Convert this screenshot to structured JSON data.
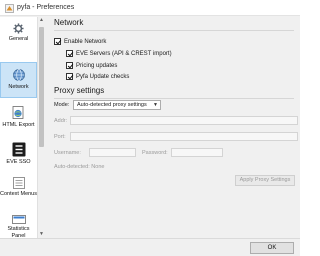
{
  "window": {
    "title": "pyfa - Preferences"
  },
  "sidebar": {
    "items": [
      {
        "label": "General",
        "icon": "gear-icon",
        "selected": false
      },
      {
        "label": "Network",
        "icon": "network-icon",
        "selected": true
      },
      {
        "label": "HTML Export",
        "icon": "html-export-icon",
        "selected": false
      },
      {
        "label": "EVE SSO",
        "icon": "eve-sso-icon",
        "selected": false
      },
      {
        "label": "Context Menus",
        "icon": "context-menus-icon",
        "selected": false
      },
      {
        "label": "Statistics Panel",
        "icon": "statistics-panel-icon",
        "selected": false
      }
    ]
  },
  "network": {
    "title": "Network",
    "enable_network": {
      "label": "Enable Network",
      "checked": true
    },
    "options": [
      {
        "label": "EVE Servers (API & CREST import)",
        "checked": true
      },
      {
        "label": "Pricing updates",
        "checked": true
      },
      {
        "label": "Pyfa Update checks",
        "checked": true
      }
    ]
  },
  "proxy": {
    "title": "Proxy settings",
    "mode_label": "Mode:",
    "mode_value": "Auto-detected proxy settings",
    "addr_label": "Addr:",
    "port_label": "Port:",
    "username_label": "Username:",
    "password_label": "Password:",
    "auto_detected": "Auto-detected: None",
    "apply_button": "Apply Proxy Settings"
  },
  "footer": {
    "ok_label": "OK"
  },
  "colors": {
    "selected_bg": "#cce4f7",
    "selected_border": "#99c9ef",
    "disabled_text": "#9a9a9a"
  }
}
